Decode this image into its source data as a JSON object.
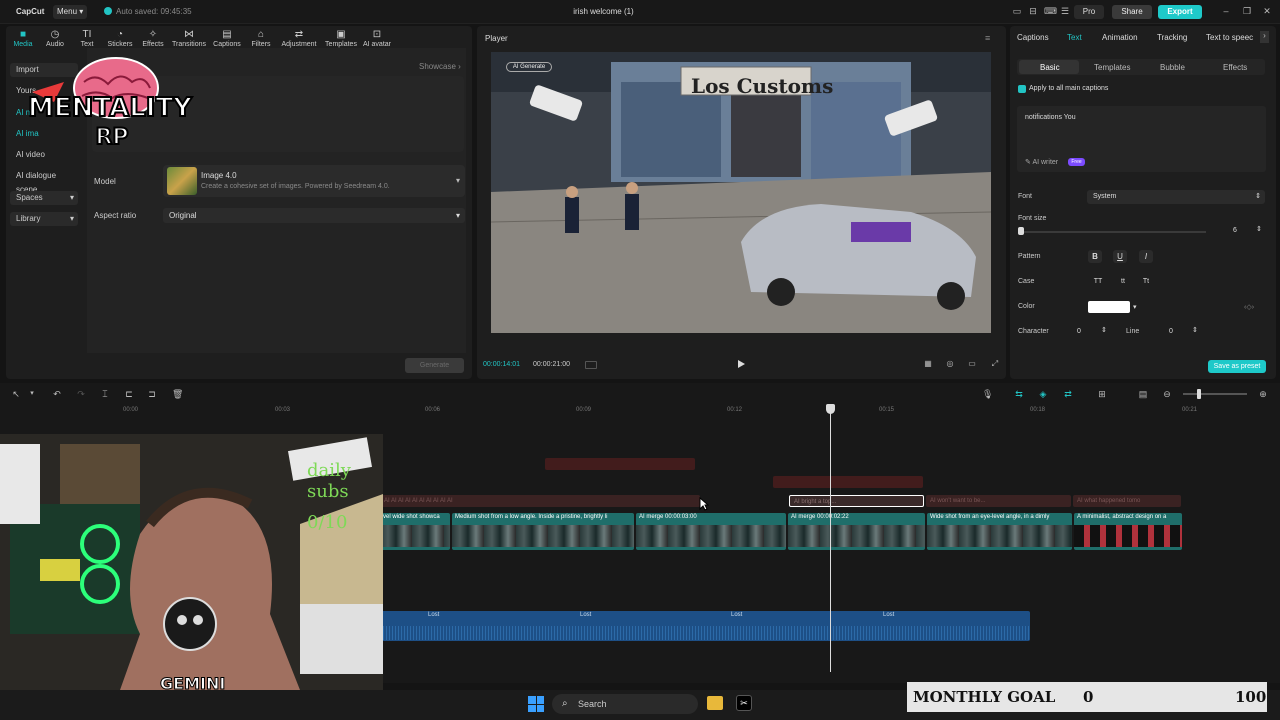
{
  "titlebar": {
    "app_name": "CapCut",
    "menu_label": "Menu",
    "autosave": "Auto saved: 09:45:35",
    "project_title": "irish welcome (1)",
    "pro_label": "Pro",
    "share_label": "Share",
    "export_label": "Export"
  },
  "left_toolbar": [
    {
      "label": "Media",
      "icon": "media-icon",
      "active": true
    },
    {
      "label": "Audio",
      "icon": "audio-icon"
    },
    {
      "label": "Text",
      "icon": "text-icon"
    },
    {
      "label": "Stickers",
      "icon": "stickers-icon"
    },
    {
      "label": "Effects",
      "icon": "effects-icon"
    },
    {
      "label": "Transitions",
      "icon": "transitions-icon"
    },
    {
      "label": "Captions",
      "icon": "captions-icon"
    },
    {
      "label": "Filters",
      "icon": "filters-icon"
    },
    {
      "label": "Adjustment",
      "icon": "adjustment-icon"
    },
    {
      "label": "Templates",
      "icon": "templates-icon"
    },
    {
      "label": "AI avatar",
      "icon": "ai-avatar-icon"
    }
  ],
  "sidebar": {
    "items": [
      "Import",
      "Yours",
      "AI m",
      "AI ima",
      "AI video",
      "AI dialogue scene",
      "Spaces",
      "Library"
    ]
  },
  "media_panel": {
    "showcase_label": "Showcase",
    "model_label": "Model",
    "model_name": "Image 4.0",
    "model_desc": "Create a cohesive set of images. Powered by Seedream 4.0.",
    "aspect_label": "Aspect ratio",
    "aspect_value": "Original",
    "generate_label": "Generate"
  },
  "player": {
    "title": "Player",
    "ai_badge": "AI Generate",
    "sign_text": "Los Customs",
    "current_time": "00:00:14:01",
    "total_time": "00:00:21:00"
  },
  "right_panel": {
    "tabs": [
      "Captions",
      "Text",
      "Animation",
      "Tracking",
      "Text to speec"
    ],
    "active_tab": "Text",
    "subtabs": [
      "Basic",
      "Templates",
      "Bubble",
      "Effects"
    ],
    "apply_all": "Apply to all main captions",
    "text_value": "notifications You",
    "ai_writer": "AI writer",
    "free_badge": "Free",
    "font_label": "Font",
    "font_value": "System",
    "font_size_label": "Font size",
    "font_size_value": "6",
    "pattern_label": "Pattern",
    "pattern_buttons": [
      "B",
      "U",
      "I"
    ],
    "case_label": "Case",
    "case_buttons": [
      "TT",
      "tt",
      "Tt"
    ],
    "color_label": "Color",
    "character_label": "Character",
    "character_value": "0",
    "line_label": "Line",
    "line_value": "0",
    "save_preset": "Save as preset",
    "text_color": "#ffffff"
  },
  "timeline": {
    "ruler": [
      "00:00",
      "00:03",
      "00:06",
      "00:09",
      "00:12",
      "00:15",
      "00:18",
      "00:21"
    ],
    "captions": [
      "AI AI AI AI AI AI AI AI AI AI",
      "AI bright a top...",
      "AI won't want to be...",
      "AI what happened tomo"
    ],
    "clips": [
      "vel wide shot showca",
      "Medium shot from a low angle. Inside a pristine, brightly li",
      "AI merge  00:00:03:00",
      "AI merge  00:00:02:22",
      "Wide shot from an eye-level angle, in a dimly",
      "A minimalist, abstract design on a"
    ],
    "audio_labels": [
      "Lost",
      "Lost",
      "Lost",
      "Lost"
    ]
  },
  "stream_overlay": {
    "daily_subs": "daily subs",
    "subs_count": "0/10",
    "logo_text": "MENTALITY RP",
    "gemini_text": "GEMINI"
  },
  "taskbar": {
    "search_placeholder": "Search"
  },
  "goal": {
    "label": "MONTHLY GOAL",
    "current": "0",
    "target": "100"
  },
  "colors": {
    "accent": "#22c4c4",
    "clip": "#1f6e6a",
    "audio": "#1d4f86",
    "free_badge": "#7c4bff"
  }
}
